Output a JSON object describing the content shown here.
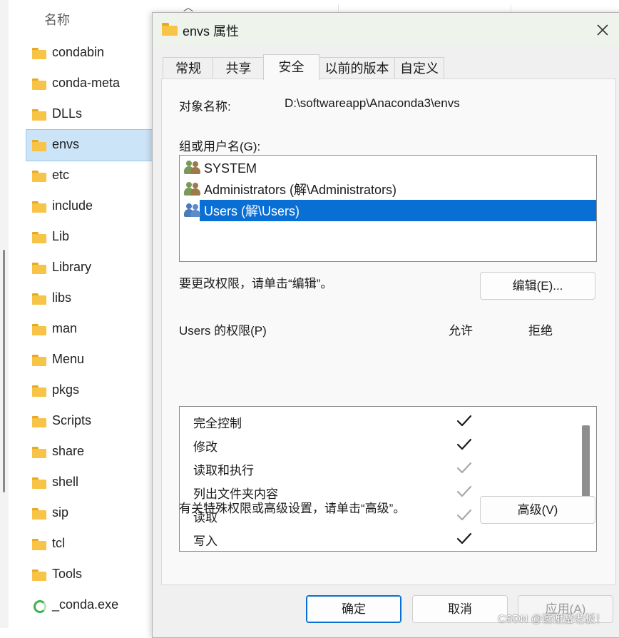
{
  "explorer": {
    "column_name": "名称",
    "files": [
      {
        "name": "condabin",
        "type": "folder"
      },
      {
        "name": "conda-meta",
        "type": "folder"
      },
      {
        "name": "DLLs",
        "type": "folder"
      },
      {
        "name": "envs",
        "type": "folder",
        "selected": true
      },
      {
        "name": "etc",
        "type": "folder"
      },
      {
        "name": "include",
        "type": "folder"
      },
      {
        "name": "Lib",
        "type": "folder"
      },
      {
        "name": "Library",
        "type": "folder"
      },
      {
        "name": "libs",
        "type": "folder"
      },
      {
        "name": "man",
        "type": "folder"
      },
      {
        "name": "Menu",
        "type": "folder"
      },
      {
        "name": "pkgs",
        "type": "folder"
      },
      {
        "name": "Scripts",
        "type": "folder"
      },
      {
        "name": "share",
        "type": "folder"
      },
      {
        "name": "shell",
        "type": "folder"
      },
      {
        "name": "sip",
        "type": "folder"
      },
      {
        "name": "tcl",
        "type": "folder"
      },
      {
        "name": "Tools",
        "type": "folder"
      },
      {
        "name": "_conda.exe",
        "type": "exe"
      }
    ]
  },
  "dialog": {
    "title": "envs 属性",
    "tabs": [
      "常规",
      "共享",
      "安全",
      "以前的版本",
      "自定义"
    ],
    "active_tab": "安全",
    "object_name_label": "对象名称:",
    "object_name_value": "D:\\softwareapp\\Anaconda3\\envs",
    "groups_label": "组或用户名(G):",
    "users": [
      {
        "name": "SYSTEM",
        "selected": false
      },
      {
        "name": "Administrators (解\\Administrators)",
        "selected": false
      },
      {
        "name": "Users (解\\Users)",
        "selected": true
      }
    ],
    "edit_hint": "要更改权限，请单击“编辑”。",
    "edit_button": "编辑(E)...",
    "permissions_label": "Users 的权限(P)",
    "allow_header": "允许",
    "deny_header": "拒绝",
    "permissions": [
      {
        "name": "完全控制",
        "allow": "explicit"
      },
      {
        "name": "修改",
        "allow": "explicit"
      },
      {
        "name": "读取和执行",
        "allow": "inherited"
      },
      {
        "name": "列出文件夹内容",
        "allow": "inherited"
      },
      {
        "name": "读取",
        "allow": "inherited"
      },
      {
        "name": "写入",
        "allow": "explicit"
      }
    ],
    "advanced_hint": "有关特殊权限或高级设置，请单击“高级”。",
    "advanced_button": "高级(V)",
    "ok_button": "确定",
    "cancel_button": "取消",
    "apply_button": "应用(A)"
  },
  "watermark": "CSDN @谢谢蟹老板！",
  "colors": {
    "selection_blue": "#0a6fd5",
    "explorer_selection": "#cce4f7",
    "folder_yellow": "#f7c448",
    "check_dark": "#1a1a1a",
    "check_inherited": "#a8a8a8"
  }
}
